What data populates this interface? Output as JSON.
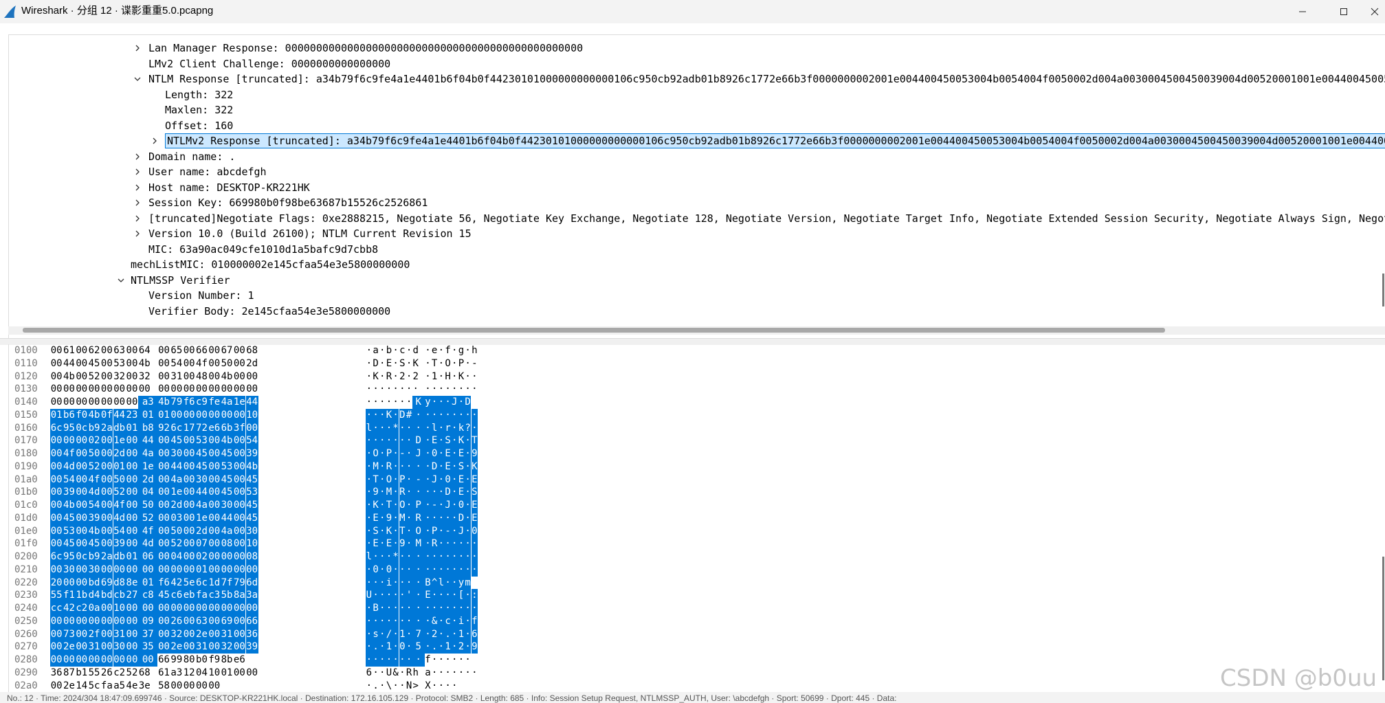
{
  "window": {
    "title": "Wireshark · 分组 12 · 谍影重重5.0.pcapng",
    "brand_color": "#1e73be",
    "selection_color": "#0078d7"
  },
  "details": {
    "rows": [
      {
        "text": "Lan Manager Response: 000000000000000000000000000000000000000000000000",
        "arrow": "collapsed",
        "level": 0
      },
      {
        "text": "LMv2 Client Challenge: 0000000000000000",
        "arrow": "none",
        "level": 0
      },
      {
        "text": "NTLM Response [truncated]: a34b79f6c9fe4a1e4401b6f04b0f44230101000000000000106c950cb92adb01b8926c1772e66b3f0000000002001e004400450053004b0054004f0050002d004a0030004500450039004d00520001001e00440045005300",
        "arrow": "expanded",
        "level": 0
      },
      {
        "text": "Length: 322",
        "arrow": "none",
        "level": 1
      },
      {
        "text": "Maxlen: 322",
        "arrow": "none",
        "level": 1
      },
      {
        "text": "Offset: 160",
        "arrow": "none",
        "level": 1
      },
      {
        "text": "NTLMv2 Response [truncated]: a34b79f6c9fe4a1e4401b6f04b0f44230101000000000000106c950cb92adb01b8926c1772e66b3f0000000002001e004400450053004b0054004f0050002d004a0030004500450039004d00520001001e0044004",
        "arrow": "collapsed",
        "level": 1,
        "selected": true
      },
      {
        "text": "Domain name: .",
        "arrow": "collapsed",
        "level": 0
      },
      {
        "text": "User name: abcdefgh",
        "arrow": "collapsed",
        "level": 0
      },
      {
        "text": "Host name: DESKTOP-KR221HK",
        "arrow": "collapsed",
        "level": 0
      },
      {
        "text": "Session Key: 669980b0f98be63687b15526c2526861",
        "arrow": "collapsed",
        "level": 0
      },
      {
        "text": " [truncated]Negotiate Flags: 0xe2888215, Negotiate 56, Negotiate Key Exchange, Negotiate 128, Negotiate Version, Negotiate Target Info, Negotiate Extended Session Security, Negotiate Always Sign, Negot",
        "arrow": "collapsed",
        "level": 0
      },
      {
        "text": "Version 10.0 (Build 26100); NTLM Current Revision 15",
        "arrow": "collapsed",
        "level": 0
      },
      {
        "text": "MIC: 63a90ac049cfe1010d1a5bafc9d7cbb8",
        "arrow": "none",
        "level": 0
      },
      {
        "text": "mechListMIC: 010000002e145cfaa54e3e5800000000",
        "arrow": "none",
        "level": -1
      },
      {
        "text": "NTLMSSP Verifier",
        "arrow": "expanded",
        "level": -1
      },
      {
        "text": "Version Number: 1",
        "arrow": "none",
        "level": 0
      },
      {
        "text": "Verifier Body: 2e145cfaa54e3e5800000000",
        "arrow": "none",
        "level": 0
      }
    ]
  },
  "bytes": {
    "rows": [
      {
        "offset": "0100",
        "hex": "00 61 00 62 00 63 00 64 00 65 00 66 00 67 00 68",
        "ascii": "·a·b·c·d·e·f·g·h",
        "hl_start": -1,
        "hl_end": -1
      },
      {
        "offset": "0110",
        "hex": "00 44 00 45 00 53 00 4b 00 54 00 4f 00 50 00 2d",
        "ascii": "·D·E·S·K·T·O·P·-",
        "hl_start": -1,
        "hl_end": -1
      },
      {
        "offset": "0120",
        "hex": "00 4b 00 52 00 32 00 32 00 31 00 48 00 4b 00 00",
        "ascii": "·K·R·2·2·1·H·K··",
        "hl_start": -1,
        "hl_end": -1
      },
      {
        "offset": "0130",
        "hex": "00 00 00 00 00 00 00 00 00 00 00 00 00 00 00 00",
        "ascii": "················",
        "hl_start": -1,
        "hl_end": -1
      },
      {
        "offset": "0140",
        "hex": "00 00 00 00 00 00 00 00 a3 4b 79 f6 c9 fe 4a 1e 44",
        "ascii": "········ Ky···J·D",
        "hl_start": 8,
        "hl_end": 16,
        "hex_fix": "00 00 00 00 00 00 00 a3 4b 79 f6 c9 fe 4a 1e 44",
        "ascii_fix": "·······  Ky···J·D"
      },
      {
        "offset": "0150",
        "hex": "01 b6 f0 4b 0f 44 23 01 01 00 00 00 00 00 00 10",
        "ascii": "···K·D#· ········",
        "hl_start": 0,
        "hl_end": 16
      },
      {
        "offset": "0160",
        "hex": "6c 95 0c b9 2a db 01 b8 92 6c 17 72 e6 6b 3f 00",
        "ascii": "l···*··· ·l·r·k?·",
        "hl_start": 0,
        "hl_end": 16
      },
      {
        "offset": "0170",
        "hex": "00 00 00 02 00 1e 00 44 00 45 00 53 00 4b 00 54",
        "ascii": "·······D ·E·S·K·T",
        "hl_start": 0,
        "hl_end": 16
      },
      {
        "offset": "0180",
        "hex": "00 4f 00 50 00 2d 00 4a 00 30 00 45 00 45 00 39",
        "ascii": "·O·P·-·J ·0·E·E·9",
        "hl_start": 0,
        "hl_end": 16
      },
      {
        "offset": "0190",
        "hex": "00 4d 00 52 00 01 00 1e 00 44 00 45 00 53 00 4b",
        "ascii": "·M·R···· ·D·E·S·K",
        "hl_start": 0,
        "hl_end": 16
      },
      {
        "offset": "01a0",
        "hex": "00 54 00 4f 00 50 00 2d 00 4a 00 30 00 45 00 45",
        "ascii": "·T·O·P·- ·J·0·E·E",
        "hl_start": 0,
        "hl_end": 16
      },
      {
        "offset": "01b0",
        "hex": "00 39 00 4d 00 52 00 04 00 1e 00 44 00 45 00 53",
        "ascii": "·9·M·R·· ···D·E·S",
        "hl_start": 0,
        "hl_end": 16
      },
      {
        "offset": "01c0",
        "hex": "00 4b 00 54 00 4f 00 50 00 2d 00 4a 00 30 00 45",
        "ascii": "·K·T·O·P ·-·J·0·E",
        "hl_start": 0,
        "hl_end": 16
      },
      {
        "offset": "01d0",
        "hex": "00 45 00 39 00 4d 00 52 00 03 00 1e 00 44 00 45",
        "ascii": "·E·9·M·R ·····D·E",
        "hl_start": 0,
        "hl_end": 16
      },
      {
        "offset": "01e0",
        "hex": "00 53 00 4b 00 54 00 4f 00 50 00 2d 00 4a 00 30",
        "ascii": "·S·K·T·O ·P·-·J·0",
        "hl_start": 0,
        "hl_end": 16
      },
      {
        "offset": "01f0",
        "hex": "00 45 00 45 00 39 00 4d 00 52 00 07 00 08 00 10",
        "ascii": "·E·E·9·M ·R······",
        "hl_start": 0,
        "hl_end": 16
      },
      {
        "offset": "0200",
        "hex": "6c 95 0c b9 2a db 01 06 00 04 00 02 00 00 00 08",
        "ascii": "l···*··· ········",
        "hl_start": 0,
        "hl_end": 16
      },
      {
        "offset": "0210",
        "hex": "00 30 00 30 00 00 00 00 00 00 00 01 00 00 00 00",
        "ascii": "·0·0···· ········",
        "hl_start": 0,
        "hl_end": 16
      },
      {
        "offset": "0220",
        "hex": "20 00 00 bd 69 d8 8e 01 f6 42 5e 6c 1d 7f 79 6d",
        "ascii": " ···i··· ·B^l··ym",
        "hl_start": 0,
        "hl_end": 16
      },
      {
        "offset": "0230",
        "hex": "55 f1 1b d4 bd cb 27 c8 45 c6 eb fa c3 5b 8a 3a",
        "ascii": "U·····'· E····[·:",
        "hl_start": 0,
        "hl_end": 16
      },
      {
        "offset": "0240",
        "hex": "cc 42 c2 0a 00 10 00 00 00 00 00 00 00 00 00 00",
        "ascii": "·B······ ········",
        "hl_start": 0,
        "hl_end": 16
      },
      {
        "offset": "0250",
        "hex": "00 00 00 00 00 00 00 09 00 26 00 63 00 69 00 66",
        "ascii": "········ ·&·c·i·f",
        "hl_start": 0,
        "hl_end": 16
      },
      {
        "offset": "0260",
        "hex": "00 73 00 2f 00 31 00 37 00 32 00 2e 00 31 00 36",
        "ascii": "·s·/·1·7 ·2·.·1·6",
        "hl_start": 0,
        "hl_end": 16
      },
      {
        "offset": "0270",
        "hex": "00 2e 00 31 00 30 00 35 00 2e 00 31 00 32 00 39",
        "ascii": "·.·1·0·5 ·.·1·2·9",
        "hl_start": 0,
        "hl_end": 16
      },
      {
        "offset": "0280",
        "hex": "00 00 00 00 00 00 00 00 66 99 80 b0 f9 8b e6",
        "ascii": "········f······",
        "hl_start": 0,
        "hl_end": 8
      },
      {
        "offset": "0290",
        "hex": "36 87 b1 55 26 c2 52 68 61 a3 12 04 10 01 00 00",
        "ascii": "6··U&·Rh a·······",
        "hl_start": -1,
        "hl_end": -1
      },
      {
        "offset": "02a0",
        "hex": "00 2e 14 5c fa a5 4e 3e 58 00 00 00 00",
        "ascii": "·.·\\··N> X····",
        "hl_start": -1,
        "hl_end": -1
      }
    ]
  },
  "status": {
    "text": "No.: 12 · Time: 2024/304 18:47:09.699746 · Source: DESKTOP-KR221HK.local · Destination: 172.16.105.129 · Protocol: SMB2 · Length: 685 · Info: Session Setup Request, NTLMSSP_AUTH, User: \\abcdefgh · Sport: 50699 · Dport: 445 · Data:"
  },
  "watermark": {
    "text": "CSDN @b0uu"
  }
}
